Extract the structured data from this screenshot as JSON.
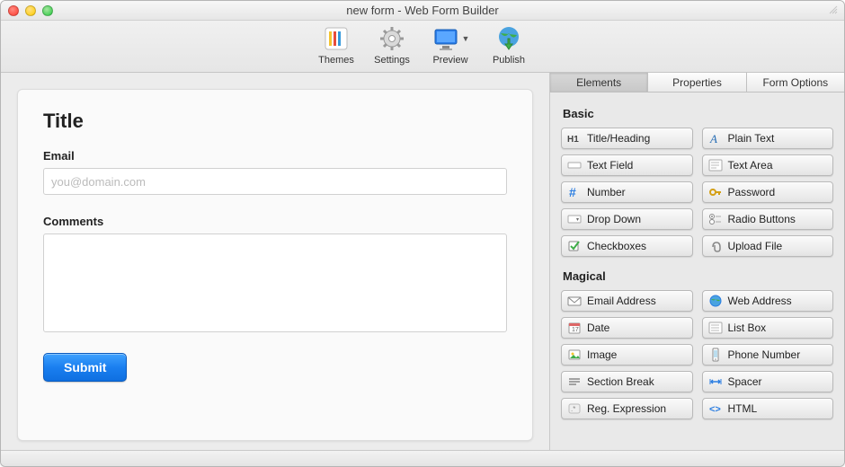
{
  "window": {
    "title": "new form - Web Form Builder"
  },
  "toolbar": {
    "themes": "Themes",
    "settings": "Settings",
    "preview": "Preview",
    "publish": "Publish"
  },
  "form": {
    "title": "Title",
    "email_label": "Email",
    "email_placeholder": "you@domain.com",
    "comments_label": "Comments",
    "submit_label": "Submit"
  },
  "tabs": {
    "elements": "Elements",
    "properties": "Properties",
    "form_options": "Form Options"
  },
  "sections": {
    "basic": "Basic",
    "magical": "Magical"
  },
  "elements": {
    "basic": {
      "title_heading": "Title/Heading",
      "plain_text": "Plain Text",
      "text_field": "Text Field",
      "text_area": "Text Area",
      "number": "Number",
      "password": "Password",
      "drop_down": "Drop Down",
      "radio_buttons": "Radio Buttons",
      "checkboxes": "Checkboxes",
      "upload_file": "Upload File"
    },
    "magical": {
      "email_address": "Email Address",
      "web_address": "Web Address",
      "date": "Date",
      "list_box": "List Box",
      "image": "Image",
      "phone_number": "Phone Number",
      "section_break": "Section Break",
      "spacer": "Spacer",
      "reg_expression": "Reg. Expression",
      "html": "HTML"
    }
  }
}
